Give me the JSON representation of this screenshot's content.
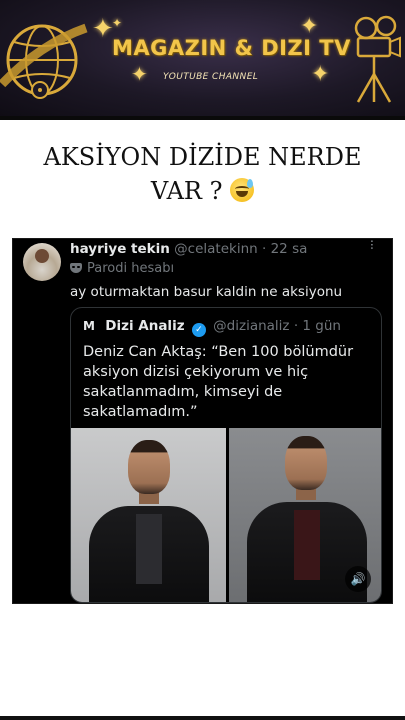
{
  "banner": {
    "title": "MAGAZIN & DIZI TV",
    "subtitle": "YOUTUBE CHANNEL",
    "sparkle_glyph": "✦",
    "colors": {
      "gold": "#f2c54a",
      "background": "#1d1826"
    },
    "icons": [
      "globe-film-reel-icon",
      "film-camera-icon"
    ]
  },
  "caption": {
    "line1": "AKSİYON DİZİDE NERDE",
    "line2": "VAR ?",
    "emoji": "grinning-sweat-emoji"
  },
  "tweet": {
    "author_name": "hayriye tekin",
    "handle": "@celatekinn",
    "separator": "·",
    "time": "22 sa",
    "more_glyph": "···",
    "parody_label": "Parodi hesabı",
    "text": "ay oturmaktan basur kaldin ne aksiyonu",
    "quote": {
      "logo_text": "M",
      "author_name": "Dizi Analiz",
      "verified_glyph": "✓",
      "handle": "@dizianaliz",
      "separator": "·",
      "time": "1 gün",
      "text": "Deniz Can Aktaş: “Ben 100 bölümdür aksiyon dizisi çekiyorum ve hiç sakatlanmadım, kimseyi de sakatlamadım.”",
      "sound_glyph": "🔊"
    }
  }
}
